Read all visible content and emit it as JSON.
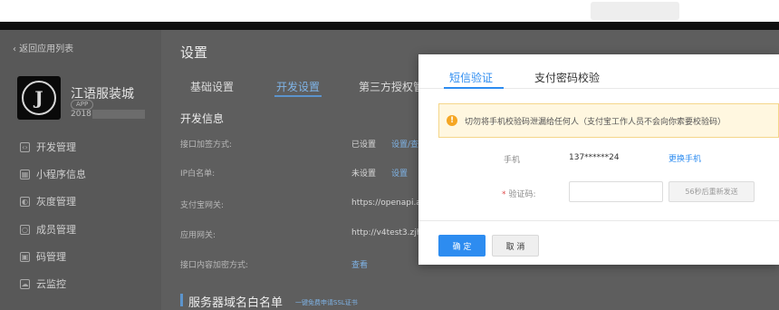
{
  "sidebar": {
    "back_label": "‹ 返回应用列表",
    "app_name": "江语服装城",
    "app_tag": "APP",
    "app_id": "2018",
    "logo_letter": "J",
    "menu": [
      {
        "label": "开发管理",
        "icon": "code-icon"
      },
      {
        "label": "小程序信息",
        "icon": "grid-icon"
      },
      {
        "label": "灰度管理",
        "icon": "gray-release-icon"
      },
      {
        "label": "成员管理",
        "icon": "member-icon"
      },
      {
        "label": "码管理",
        "icon": "code-manage-icon"
      },
      {
        "label": "云监控",
        "icon": "cloud-icon"
      }
    ]
  },
  "main": {
    "title": "设置",
    "tabs": [
      "基础设置",
      "开发设置",
      "第三方授权管"
    ],
    "active_tab": "开发设置",
    "section_title": "开发信息",
    "rows": [
      {
        "label": "接口加签方式:",
        "value": "已设置",
        "link": "设置/查"
      },
      {
        "label": "IP白名单:",
        "value": "未设置",
        "link": "设置"
      },
      {
        "label": "支付宝网关:",
        "value": "https://openapi.a"
      },
      {
        "label": "应用网关:",
        "value": "http://v4test3.zjh"
      },
      {
        "label": "接口内容加密方式:",
        "value": "查看"
      }
    ],
    "server_title": "服务器域名白名单",
    "server_link": "一键免费申请SSL证书"
  },
  "modal": {
    "tabs": [
      "短信验证",
      "支付密码校验"
    ],
    "active_tab": "短信验证",
    "alert_text": "切勿将手机校验码泄漏给任何人（支付宝工作人员不会向你索要校验码）",
    "phone_label": "手机",
    "phone_value": "137******24",
    "change_phone": "更换手机",
    "code_label": "验证码:",
    "code_value": "",
    "resend_label": "56秒后重新发送",
    "ok_label": "确 定",
    "cancel_label": "取 消"
  },
  "colors": {
    "accent": "#2d8cf0",
    "warning_bg": "#fff7e0",
    "warning_icon": "#f5a623",
    "overlay": "#5c5c5c"
  }
}
